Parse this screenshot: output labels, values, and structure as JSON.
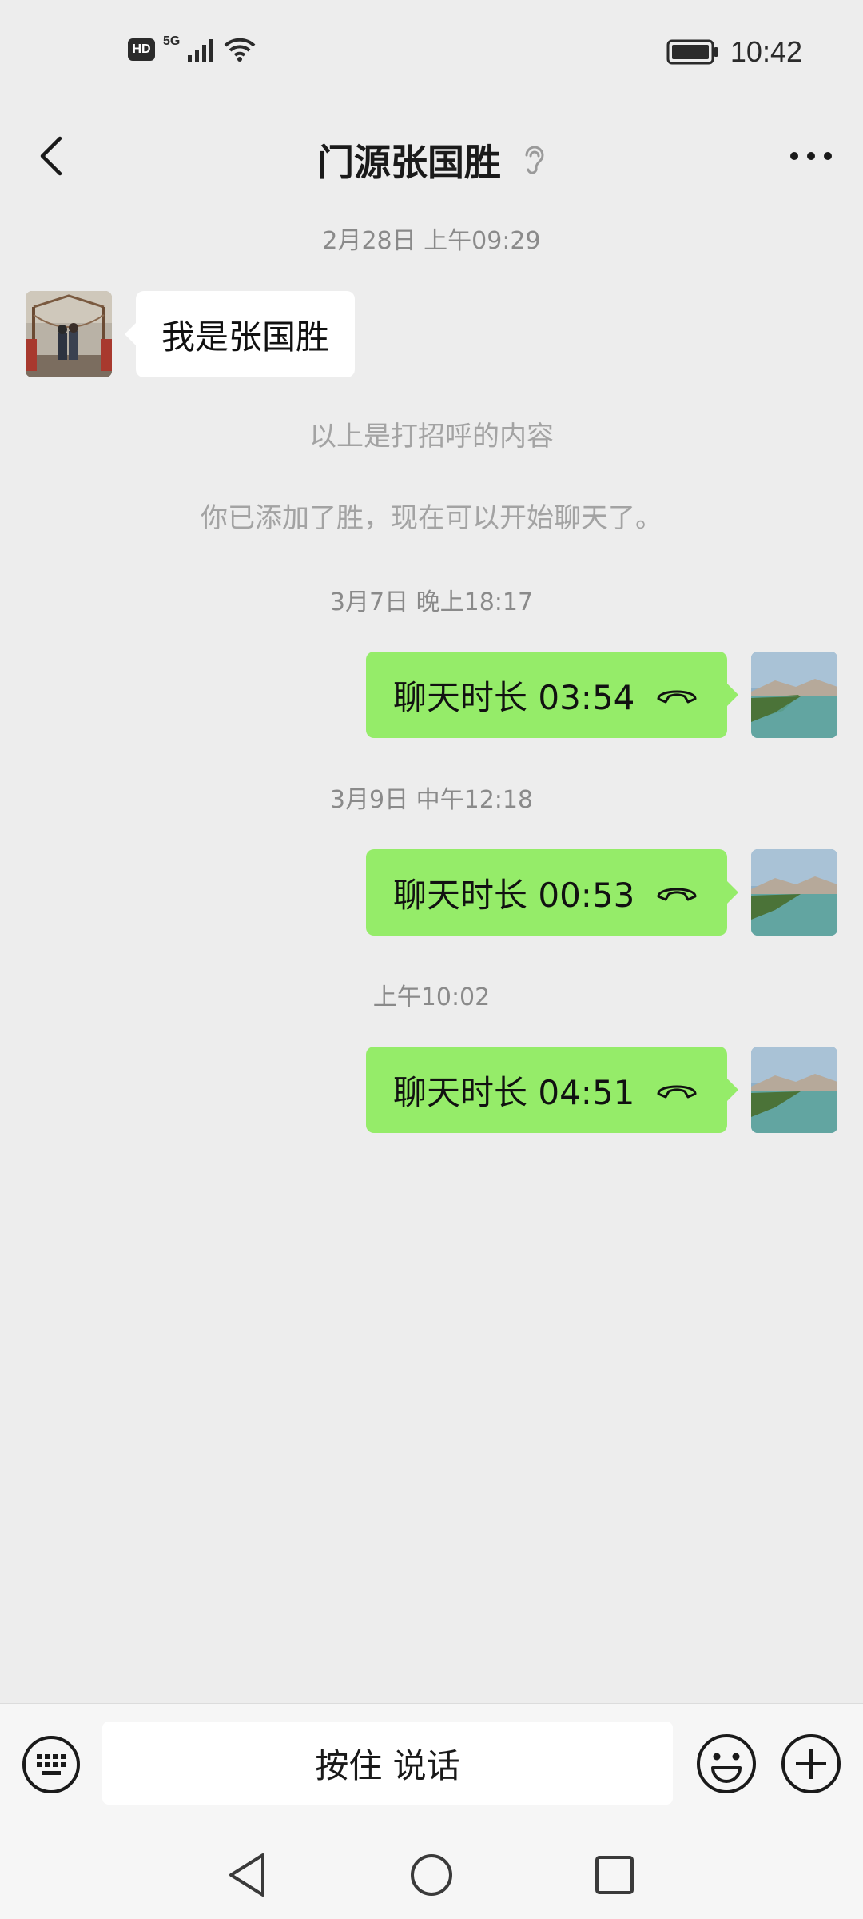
{
  "status_bar": {
    "hd": "HD",
    "network": "5G",
    "time": "10:42"
  },
  "header": {
    "title": "门源张国胜"
  },
  "messages": {
    "time1": "2月28日 上午09:29",
    "greeting": "我是张国胜",
    "sys1": "以上是打招呼的内容",
    "sys2": "你已添加了胜，现在可以开始聊天了。",
    "time2": "3月7日 晚上18:17",
    "call1": "聊天时长 03:54",
    "time3": "3月9日 中午12:18",
    "call2": "聊天时长 00:53",
    "time4": "上午10:02",
    "call3": "聊天时长 04:51"
  },
  "input_bar": {
    "hold_to_talk": "按住 说话"
  },
  "colors": {
    "background": "#ededed",
    "outgoing_bubble": "#95ec69",
    "incoming_bubble": "#ffffff"
  }
}
